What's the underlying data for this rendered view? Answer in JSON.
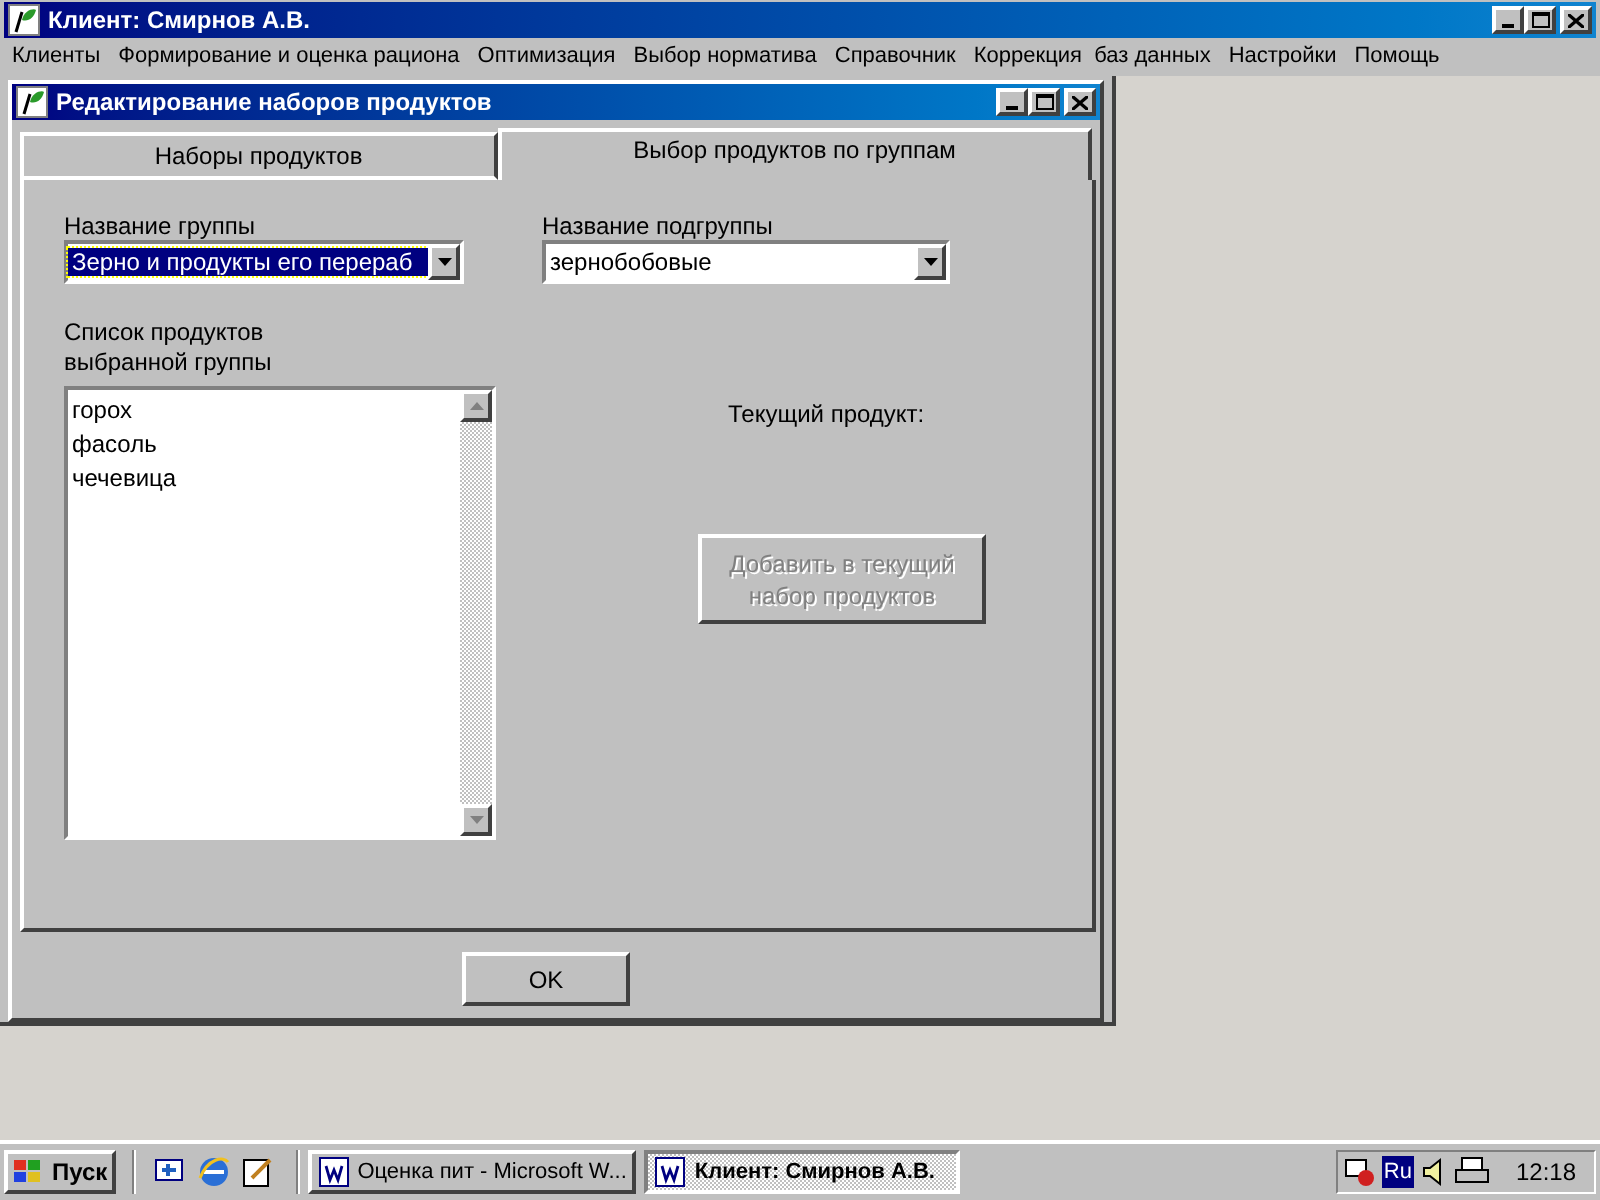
{
  "window": {
    "title": "Клиент: Смирнов А.В."
  },
  "menu": [
    "Клиенты",
    "Формирование и оценка рациона",
    "Оптимизация",
    "Выбор норматива",
    "Справочник",
    "Коррекция  баз данных",
    "Настройки",
    "Помощь"
  ],
  "dialog": {
    "title": "Редактирование наборов продуктов",
    "tabs": [
      {
        "label": "Наборы продуктов",
        "selected": false
      },
      {
        "label": "Выбор продуктов по группам",
        "selected": true
      }
    ],
    "group_label": "Название группы",
    "group_combo": {
      "value": "Зерно и продукты его перераб",
      "highlighted": true
    },
    "subgroup_label": "Название подгруппы",
    "subgroup_combo": {
      "value": "зернобобовые",
      "highlighted": false
    },
    "list_label": "Список продуктов выбранной группы",
    "products": [
      "горох",
      "фасоль",
      "чечевица"
    ],
    "current_product_label": "Текущий продукт:",
    "add_button": {
      "label": "Добавить в текущий набор продуктов",
      "disabled": true
    },
    "ok_button": {
      "label": "OK",
      "disabled": false
    }
  },
  "taskbar": {
    "start": "Пуск",
    "tasks": [
      {
        "label": "Оценка пит - Microsoft W...",
        "selected": false
      },
      {
        "label": "Клиент: Смирнов А.В.",
        "selected": true
      }
    ],
    "language": "Ru",
    "clock": "12:18"
  }
}
